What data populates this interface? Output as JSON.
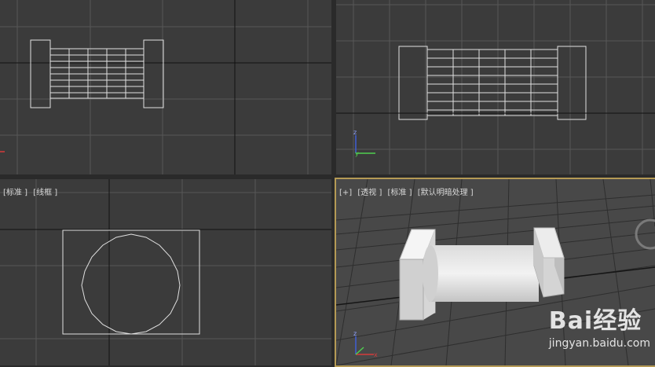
{
  "viewports": {
    "top_left": {
      "labels": []
    },
    "top_right": {
      "labels": []
    },
    "bottom_left": {
      "labels": [
        "[标准 ]",
        "[线框 ]"
      ]
    },
    "bottom_right": {
      "labels": [
        "[+]",
        "[透视 ]",
        "[标准 ]",
        "[默认明暗处理 ]"
      ]
    }
  },
  "axis": {
    "z": "z",
    "y": "y",
    "x": "x"
  },
  "colors": {
    "grid": "#595959",
    "axis_line": "#101010",
    "wire": "#e6e6e6",
    "active_border": "#b59a55",
    "axis_z": "#3f5fd6",
    "axis_y": "#4fcf4f",
    "axis_x": "#d63a3a"
  },
  "watermark": {
    "logo": "Bai经验",
    "url": "jingyan.baidu.com"
  }
}
